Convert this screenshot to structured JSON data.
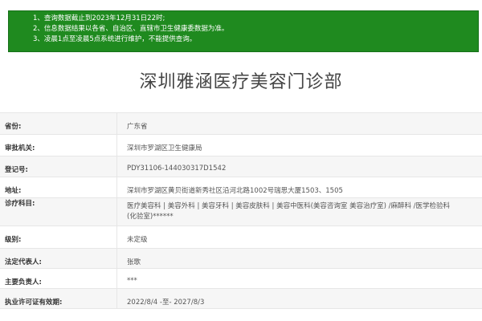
{
  "notice": {
    "lines": [
      "1、查询数据截止到2023年12月31日22时;",
      "2、信息数据结果以各省、自治区、直辖市卫生健康委数据为准。",
      "3、凌晨1点至凌晨5点系统进行维护，不能提供查询。"
    ]
  },
  "title": "深圳雅涵医疗美容门诊部",
  "rows": [
    {
      "label": "省份:",
      "value": "广东省"
    },
    {
      "label": "审批机关:",
      "value": "深圳市罗湖区卫生健康局"
    },
    {
      "label": "登记号:",
      "value": "PDY31106-144030317D1542"
    },
    {
      "label": "地址:",
      "value": "深圳市罗湖区黄贝街道新秀社区沿河北路1002号瑞思大厦1503、1505"
    },
    {
      "label": "诊疗科目:",
      "value_lines": [
        "医疗美容科 | 美容外科 | 美容牙科 | 美容皮肤科 | 美容中医科(美容咨询室 美容治疗室) /麻醉科 /医学检验科",
        "(化验室)******"
      ]
    },
    {
      "label": "级别:",
      "value": "未定级"
    },
    {
      "label": "法定代表人:",
      "value": "张歌"
    },
    {
      "label": "主要负责人:",
      "value": "***"
    },
    {
      "label": "执业许可证有效期:",
      "value": "2022/8/4 -至- 2027/8/3"
    }
  ],
  "colors": {
    "notice_bg": "#1f8a1f",
    "title_text": "#444444",
    "row_alt_bg": "#f6f6f6"
  }
}
